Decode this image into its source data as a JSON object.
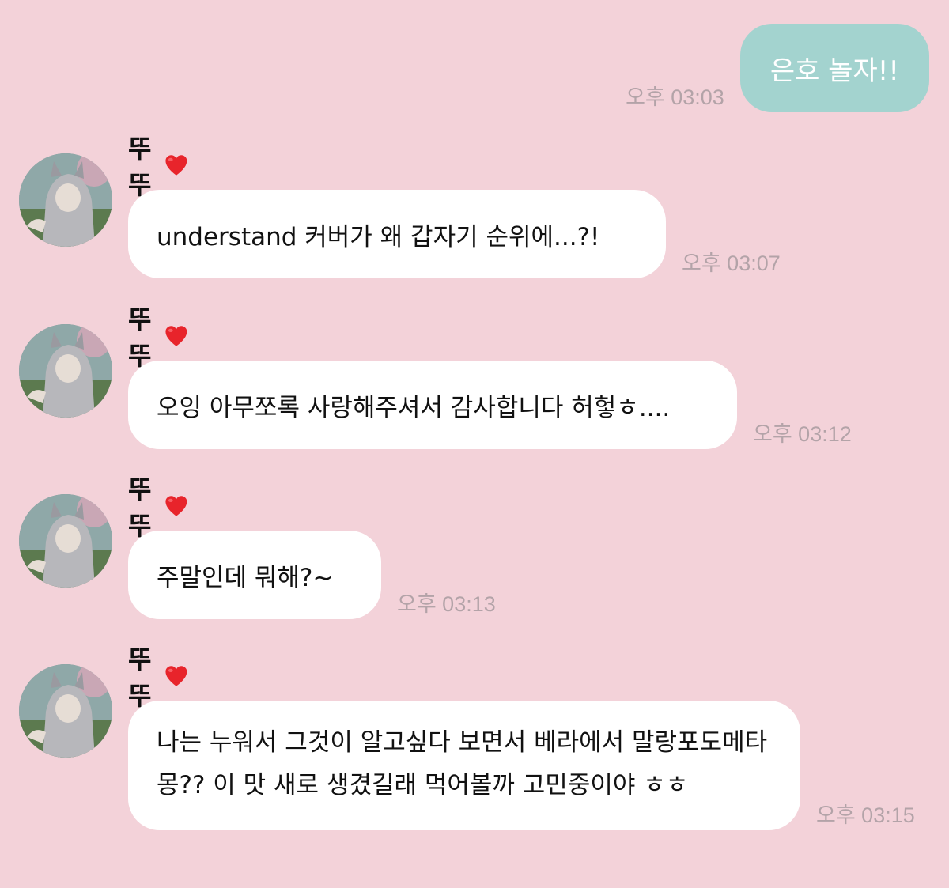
{
  "outgoing": {
    "text": "은호 놀자!!",
    "time": "오후 03:03"
  },
  "sender": {
    "name": "뚜뚜",
    "heart": "❤️"
  },
  "colors": {
    "background": "#f3d2d9",
    "outgoing_bubble": "#a3d3cf",
    "incoming_bubble": "#ffffff",
    "timestamp": "#b3a3a8",
    "heart": "#e8242b"
  },
  "messages": [
    {
      "text": "understand 커버가 왜 갑자기 순위에...?!",
      "time": "오후 03:07"
    },
    {
      "text": "오잉 아무쪼록 사랑해주셔서 감사합니다 허헣ㅎ....",
      "time": "오후 03:12"
    },
    {
      "text": "주말인데 뭐해?~",
      "time": "오후 03:13"
    },
    {
      "text": "나는 누워서 그것이 알고싶다 보면서 베라에서 말랑포도메타몽?? 이 맛 새로 생겼길래 먹어볼까 고민중이야 ㅎㅎ",
      "time": "오후 03:15"
    }
  ]
}
